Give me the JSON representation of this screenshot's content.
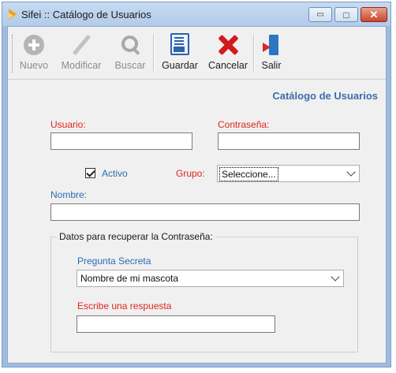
{
  "window": {
    "title": "Sifei :: Catálogo de Usuarios",
    "controls": {
      "minimize": "▭",
      "maximize": "□",
      "close": "✕"
    }
  },
  "toolbar": {
    "items": [
      {
        "label": "Nuevo",
        "icon": "plus-circle-icon",
        "enabled": false
      },
      {
        "label": "Modificar",
        "icon": "pencil-icon",
        "enabled": false
      },
      {
        "label": "Buscar",
        "icon": "search-icon",
        "enabled": false
      },
      {
        "label": "Guardar",
        "icon": "save-icon",
        "enabled": true
      },
      {
        "label": "Cancelar",
        "icon": "cancel-x-icon",
        "enabled": true
      },
      {
        "label": "Salir",
        "icon": "exit-door-icon",
        "enabled": true
      }
    ]
  },
  "form": {
    "heading": "Catálogo de Usuarios",
    "usuario": {
      "label": "Usuario:",
      "value": ""
    },
    "contrasena": {
      "label": "Contraseña:",
      "value": ""
    },
    "activo": {
      "label": "Activo",
      "checked": true
    },
    "grupo": {
      "label": "Grupo:",
      "selected": "Seleccione..."
    },
    "nombre": {
      "label": "Nombre:",
      "value": ""
    },
    "recovery": {
      "legend": "Datos para recuperar la Contraseña:",
      "pregunta_label": "Pregunta Secreta",
      "pregunta_selected": "Nombre de mi mascota",
      "respuesta_label": "Escribe una respuesta",
      "respuesta_value": ""
    }
  },
  "colors": {
    "label_red": "#e0261d",
    "label_blue": "#2e6bb3",
    "heading_blue": "#3a6eaa",
    "window_frame": "#9fbbdf"
  }
}
